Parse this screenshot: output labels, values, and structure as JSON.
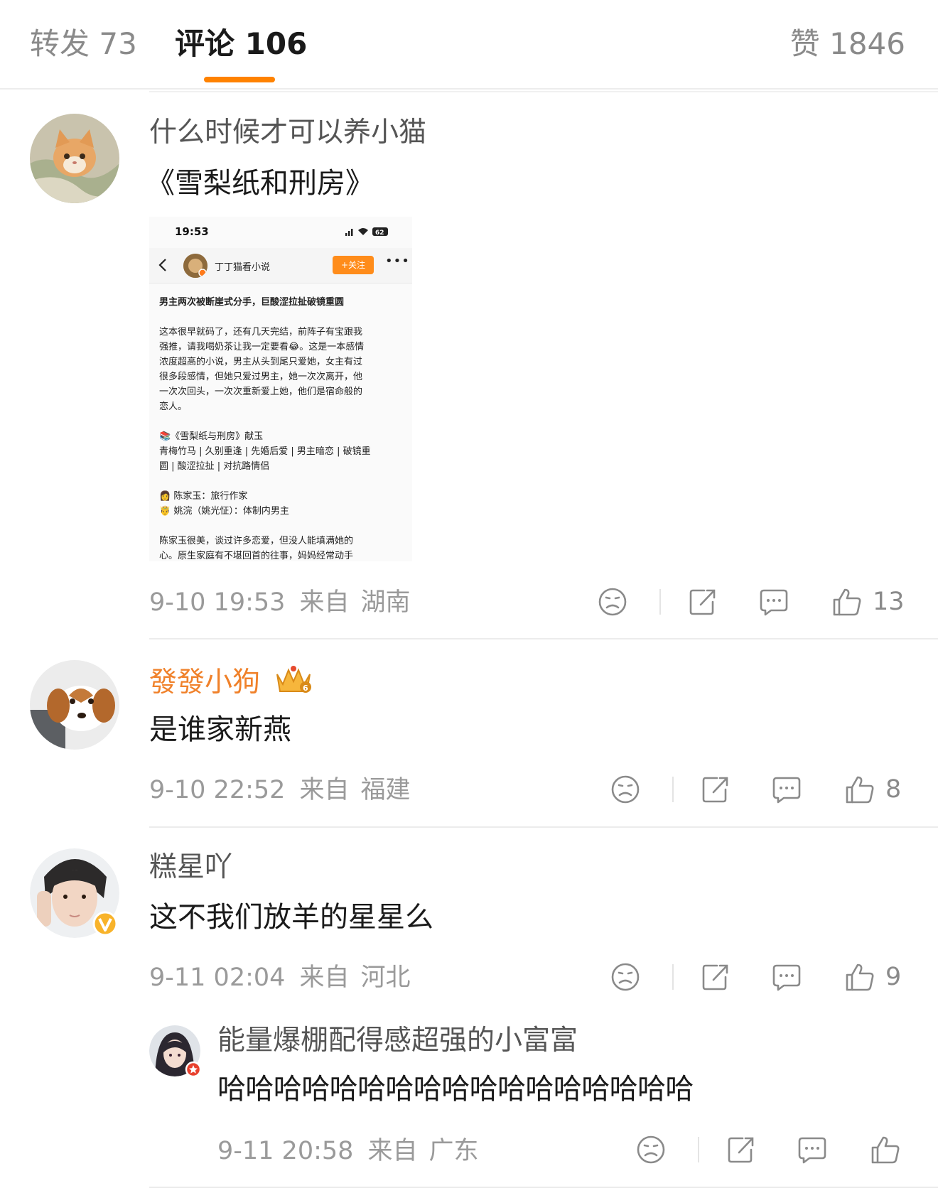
{
  "tabs": {
    "repost": "转发 73",
    "comments": "评论 106",
    "likes": "赞 1846"
  },
  "accent_color": "#ff8200",
  "comments": [
    {
      "username": "什么时候才可以养小猫",
      "text": "《雪梨纸和刑房》",
      "date": "9-10 19:53",
      "from": "来自",
      "location": "湖南",
      "likes": "13",
      "image": {
        "time": "19:53",
        "battery": "62",
        "account": "丁丁猫看小说",
        "follow": "+关注",
        "title": "男主两次被断崖式分手，巨酸涩拉扯破镜重圆",
        "para1": [
          "这本很早就码了，还有几天完结，前阵子有宝跟我",
          "强推，请我喝奶茶让我一定要看😂。这是一本感情",
          "浓度超高的小说，男主从头到尾只爱她，女主有过",
          "很多段感情，但她只爱过男主，她一次次离开，他",
          "一次次回头，一次次重新爱上她，他们是宿命般的",
          "恋人。"
        ],
        "book": "📚《雪梨纸与刑房》献玉",
        "tags": [
          "青梅竹马 | 久别重逢 | 先婚后爱 | 男主暗恋 | 破镜重",
          "圆 | 酸涩拉扯 | 对抗路情侣"
        ],
        "char1": "👩 陈家玉：旅行作家",
        "char2": "🤴 姚浣（姚光怔）：体制内男主",
        "para2": [
          "陈家玉很美，谈过许多恋爱，但没人能填满她的",
          "心。原生家庭有不堪回首的往事，妈妈经常动手"
        ]
      }
    },
    {
      "username": "發發小狗",
      "text": "是谁家新燕",
      "date": "9-10 22:52",
      "from": "来自",
      "location": "福建",
      "likes": "8"
    },
    {
      "username": "糕星吖",
      "text": "这不我们放羊的星星么",
      "date": "9-11 02:04",
      "from": "来自",
      "location": "河北",
      "likes": "9"
    },
    {
      "username": "能量爆棚配得感超强的小富富",
      "text": "哈哈哈哈哈哈哈哈哈哈哈哈哈哈哈哈哈",
      "date": "9-11 20:58",
      "from": "来自",
      "location": "广东"
    }
  ]
}
